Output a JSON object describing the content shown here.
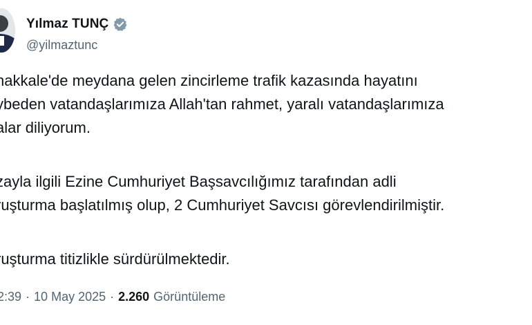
{
  "author": {
    "display_name": "Yılmaz TUNÇ",
    "handle": "@yilmaztunc",
    "verified_icon": "verified-badge-icon",
    "verified_color": "#829aab"
  },
  "tweet": {
    "lines": [
      "nakkale'de meydana gelen zincirleme trafik kazasında hayatını",
      "ybeden vatandaşlarımıza Allah'tan rahmet, yaralı vatandaşlarımıza",
      "alar diliyorum.",
      "zayla ilgili Ezine Cumhuriyet Başsavcılığımız tarafından adli",
      "ruşturma başlatılmış olup, 2 Cumhuriyet Savcısı görevlendirilmiştir.",
      "ruşturma titizlikle sürdürülmektedir."
    ]
  },
  "meta": {
    "time": "2:39",
    "separator": "·",
    "date": "10 May 2025",
    "views_count": "2.260",
    "views_label": "Görüntüleme"
  }
}
